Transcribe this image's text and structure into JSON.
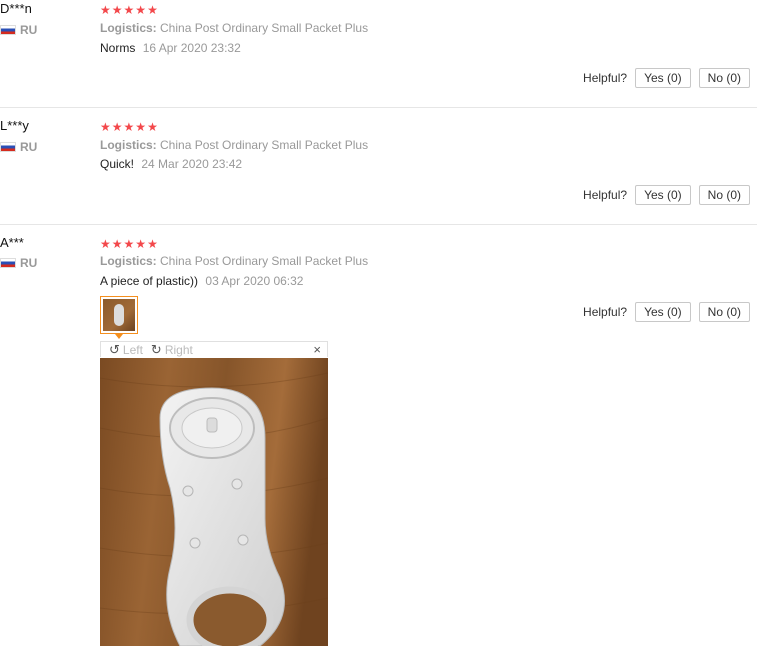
{
  "reviews": [
    {
      "user": "D***n",
      "country": "RU",
      "logistics_label": "Logistics:",
      "logistics_value": "China Post Ordinary Small Packet Plus",
      "feedback": "Norms",
      "date": "16 Apr 2020 23:32",
      "helpful_label": "Helpful?",
      "yes_label": "Yes (0)",
      "no_label": "No (0)",
      "rating": 5
    },
    {
      "user": "L***y",
      "country": "RU",
      "logistics_label": "Logistics:",
      "logistics_value": "China Post Ordinary Small Packet Plus",
      "feedback": "Quick!",
      "date": "24 Mar 2020 23:42",
      "helpful_label": "Helpful?",
      "yes_label": "Yes (0)",
      "no_label": "No (0)",
      "rating": 5
    },
    {
      "user": "A***",
      "country": "RU",
      "logistics_label": "Logistics:",
      "logistics_value": "China Post Ordinary Small Packet Plus",
      "feedback": "A piece of plastic))",
      "date": "03 Apr 2020 06:32",
      "helpful_label": "Helpful?",
      "yes_label": "Yes (0)",
      "no_label": "No (0)",
      "rating": 5
    }
  ],
  "viewer": {
    "left_label": "Left",
    "right_label": "Right",
    "close_glyph": "×"
  },
  "colors": {
    "star": "#f3484b",
    "thumb_border": "#f58f1e"
  }
}
